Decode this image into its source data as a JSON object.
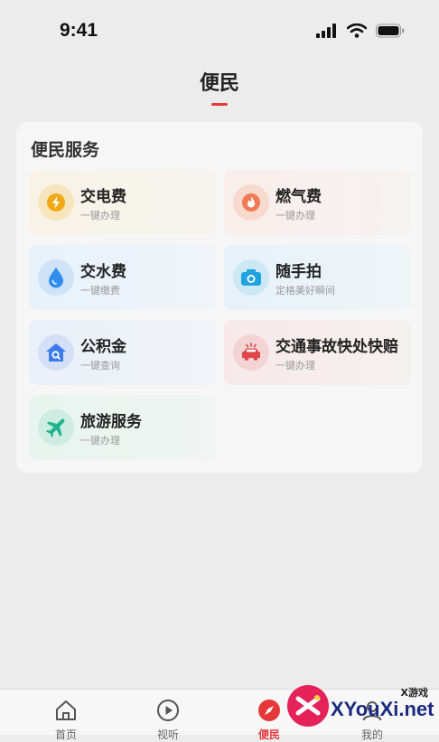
{
  "status": {
    "time": "9:41"
  },
  "page": {
    "title": "便民"
  },
  "card": {
    "title": "便民服务",
    "items": [
      {
        "title": "交电费",
        "subtitle": "一键办理",
        "icon": "lightning-icon",
        "color": "#f0a914"
      },
      {
        "title": "燃气费",
        "subtitle": "一键办理",
        "icon": "flame-icon",
        "color": "#ef7a55"
      },
      {
        "title": "交水费",
        "subtitle": "一键缴费",
        "icon": "water-drop-icon",
        "color": "#2f8ef0"
      },
      {
        "title": "随手拍",
        "subtitle": "定格美好瞬间",
        "icon": "camera-icon",
        "color": "#1ea3e0"
      },
      {
        "title": "公积金",
        "subtitle": "一键查询",
        "icon": "house-search-icon",
        "color": "#3d7bea"
      },
      {
        "title": "交通事故快处快赔",
        "subtitle": "一键办理",
        "icon": "car-accident-icon",
        "color": "#e0464a"
      },
      {
        "title": "旅游服务",
        "subtitle": "一键办理",
        "icon": "airplane-icon",
        "color": "#1fb58d"
      }
    ]
  },
  "tabbar": {
    "tabs": [
      {
        "label": "首页",
        "icon": "home-icon"
      },
      {
        "label": "视听",
        "icon": "play-icon"
      },
      {
        "label": "便民",
        "icon": "compass-icon",
        "active": true
      },
      {
        "label": "我的",
        "icon": "user-icon"
      }
    ]
  },
  "watermark": {
    "text": "XYouXi.net",
    "small": "X游戏"
  },
  "colors": {
    "accent": "#e5383b",
    "background": "#ececed"
  }
}
